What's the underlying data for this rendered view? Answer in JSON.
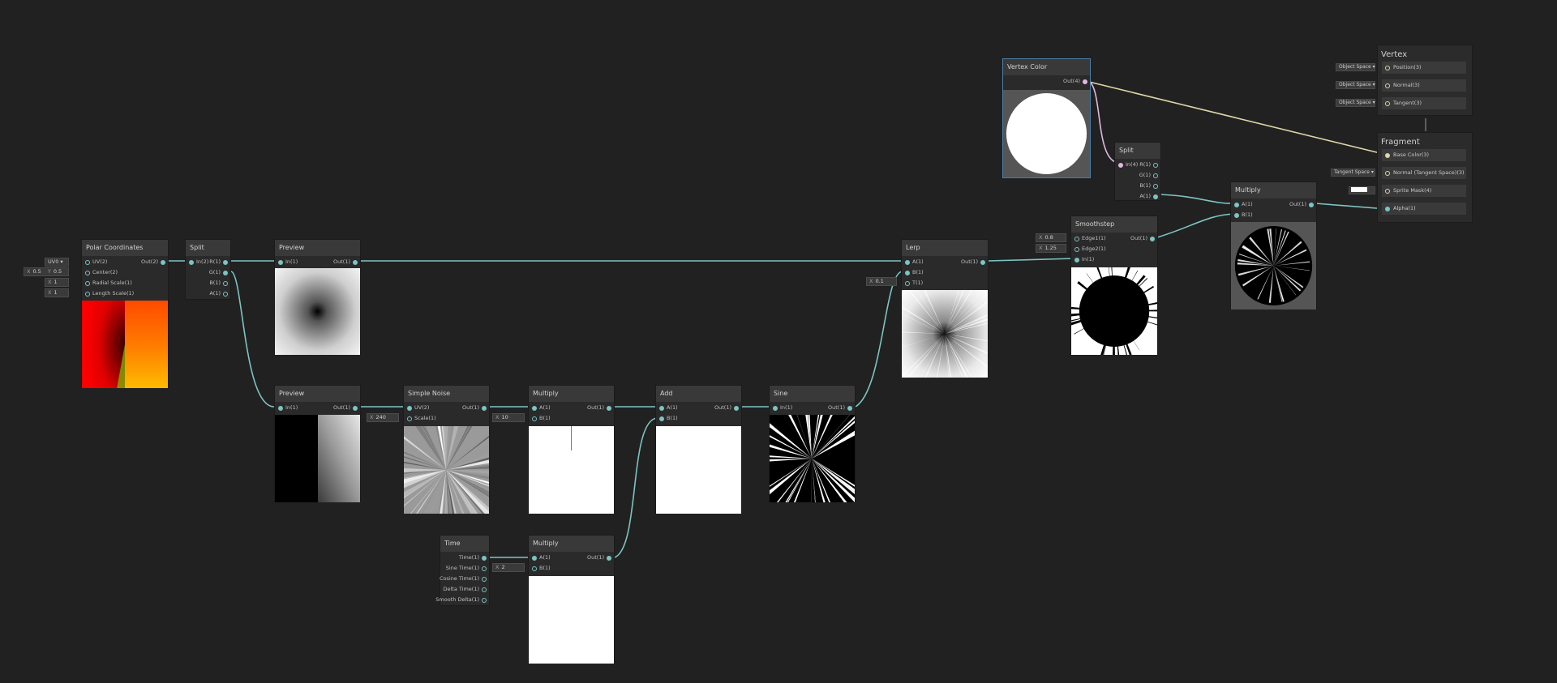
{
  "nodes": {
    "polar": {
      "title": "Polar Coordinates",
      "inputs": [
        "UV(2)",
        "Center(2)",
        "Radial Scale(1)",
        "Length Scale(1)"
      ],
      "output": "Out(2)",
      "fields": {
        "uv": "UV0",
        "center_x_label": "X",
        "center_x": "0.5",
        "center_y_label": "Y",
        "center_y": "0.5",
        "radial_label": "X",
        "radial": "1",
        "length_label": "X",
        "length": "1"
      }
    },
    "split1": {
      "title": "Split",
      "input": "In(2)",
      "outputs": [
        "R(1)",
        "G(1)",
        "B(1)",
        "A(1)"
      ]
    },
    "preview1": {
      "title": "Preview",
      "input": "In(1)",
      "output": "Out(1)"
    },
    "preview2": {
      "title": "Preview",
      "input": "In(1)",
      "output": "Out(1)"
    },
    "noise": {
      "title": "Simple Noise",
      "inputs": [
        "UV(2)",
        "Scale(1)"
      ],
      "output": "Out(1)",
      "scale_label": "X",
      "scale": "240"
    },
    "multiply1": {
      "title": "Multiply",
      "inputs": [
        "A(1)",
        "B(1)"
      ],
      "output": "Out(1)",
      "b_label": "X",
      "b": "10"
    },
    "add": {
      "title": "Add",
      "inputs": [
        "A(1)",
        "B(1)"
      ],
      "output": "Out(1)"
    },
    "sine": {
      "title": "Sine",
      "input": "In(1)",
      "output": "Out(1)"
    },
    "time": {
      "title": "Time",
      "outputs": [
        "Time(1)",
        "Sine Time(1)",
        "Cosine Time(1)",
        "Delta Time(1)",
        "Smooth Delta(1)"
      ]
    },
    "multiply2": {
      "title": "Multiply",
      "inputs": [
        "A(1)",
        "B(1)"
      ],
      "output": "Out(1)",
      "b_label": "X",
      "b": "2"
    },
    "lerp": {
      "title": "Lerp",
      "inputs": [
        "A(1)",
        "B(1)",
        "T(1)"
      ],
      "output": "Out(1)",
      "t_label": "X",
      "t": "0.1"
    },
    "vertex_color": {
      "title": "Vertex Color",
      "output": "Out(4)"
    },
    "split2": {
      "title": "Split",
      "input": "In(4)",
      "outputs": [
        "R(1)",
        "G(1)",
        "B(1)",
        "A(1)"
      ]
    },
    "smoothstep": {
      "title": "Smoothstep",
      "inputs": [
        "Edge1(1)",
        "Edge2(1)",
        "In(1)"
      ],
      "output": "Out(1)",
      "edge1_label": "X",
      "edge1": "0.8",
      "edge2_label": "X",
      "edge2": "1.25"
    },
    "multiply3": {
      "title": "Multiply",
      "inputs": [
        "A(1)",
        "B(1)"
      ],
      "output": "Out(1)"
    }
  },
  "vertex_ctx": {
    "title": "Vertex",
    "slots": [
      {
        "label": "Position(3)",
        "space": "Object Space"
      },
      {
        "label": "Normal(3)",
        "space": "Object Space"
      },
      {
        "label": "Tangent(3)",
        "space": "Object Space"
      }
    ]
  },
  "fragment_ctx": {
    "title": "Fragment",
    "slots": [
      {
        "label": "Base Color(3)",
        "space": ""
      },
      {
        "label": "Normal (Tangent Space)(3)",
        "space": "Tangent Space"
      },
      {
        "label": "Sprite Mask(4)",
        "space": ""
      },
      {
        "label": "Alpha(1)",
        "space": ""
      }
    ]
  },
  "colors": {
    "wire_float": "#7dc4c4",
    "wire_vector": "#e0b8e0",
    "wire_color": "#ddd6a8",
    "background": "#212121"
  }
}
